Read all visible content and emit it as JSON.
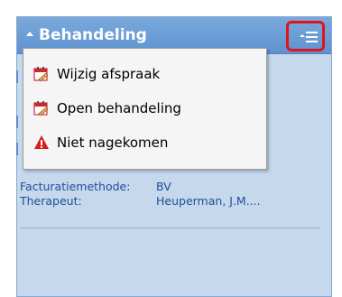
{
  "panel": {
    "title": "Behandeling",
    "menu": [
      {
        "label": "Wijzig afspraak",
        "icon": "calendar-edit-icon"
      },
      {
        "label": "Open behandeling",
        "icon": "calendar-edit-icon"
      },
      {
        "label": "Niet nagekomen",
        "icon": "warning-icon"
      }
    ]
  },
  "details": {
    "facturatie_label": "Facturatiemethode:",
    "facturatie_value": "BV",
    "therapeut_label": "Therapeut:",
    "therapeut_value": "Heuperman, J.M...."
  },
  "colors": {
    "header": "#6a9cd6",
    "panel_bg": "#c5d8ec",
    "highlight_border": "#e1141c",
    "warning": "#d81f1f"
  }
}
